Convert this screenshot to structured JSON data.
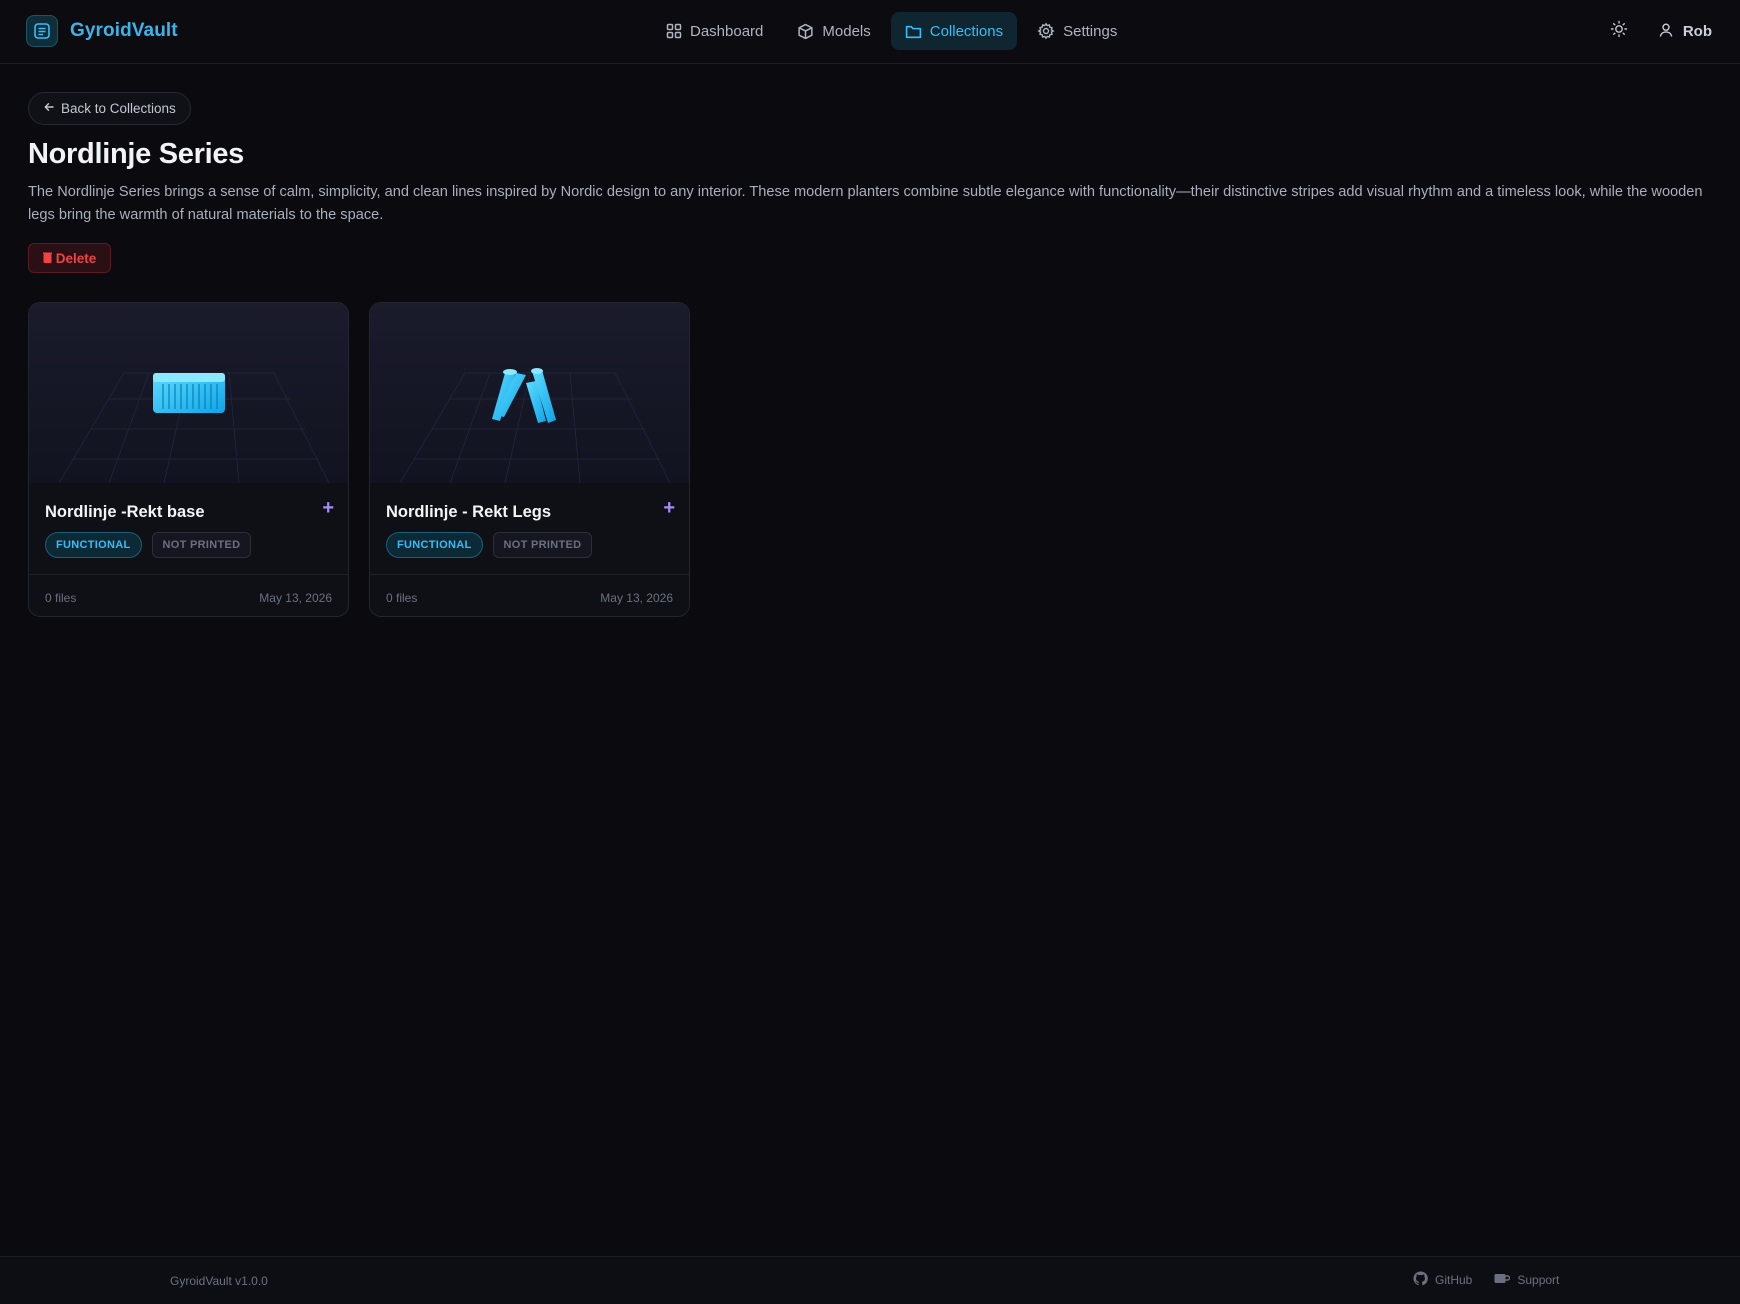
{
  "header": {
    "brand": "GyroidVault",
    "nav": [
      {
        "label": "Dashboard",
        "icon": "grid-icon"
      },
      {
        "label": "Models",
        "icon": "cube-icon"
      },
      {
        "label": "Collections",
        "icon": "folder-icon",
        "active": true
      },
      {
        "label": "Settings",
        "icon": "gear-icon"
      }
    ],
    "user": "Rob"
  },
  "main": {
    "back_label": "Back to Collections",
    "title": "Nordlinje Series",
    "description": "The Nordlinje Series brings a sense of calm, simplicity, and clean lines inspired by Nordic design to any interior. These modern planters combine subtle elegance with functionality—their distinctive stripes add visual rhythm and a timeless look, while the wooden legs bring the warmth of natural materials to the space.",
    "delete_label": "Delete",
    "cards": [
      {
        "title": "Nordlinje -Rekt base",
        "tag": "FUNCTIONAL",
        "status": "NOT PRINTED",
        "files": "0 files",
        "date": "May 13, 2026",
        "add": "+"
      },
      {
        "title": "Nordlinje - Rekt Legs",
        "tag": "FUNCTIONAL",
        "status": "NOT PRINTED",
        "files": "0 files",
        "date": "May 13, 2026",
        "add": "+"
      }
    ]
  },
  "footer": {
    "version": "GyroidVault v1.0.0",
    "github": "GitHub",
    "support": "Support"
  },
  "colors": {
    "background": "#0a0a0f",
    "accent": "#38bdf8",
    "danger": "#ef4444",
    "add": "#a78bfa"
  }
}
